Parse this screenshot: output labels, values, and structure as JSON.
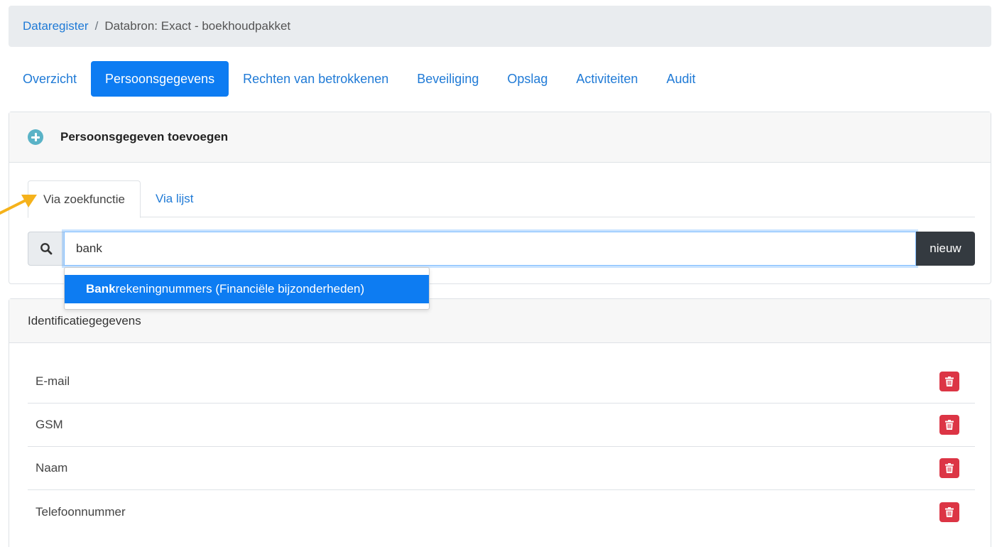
{
  "breadcrumb": {
    "root": "Dataregister",
    "separator": "/",
    "current": "Databron: Exact - boekhoudpakket"
  },
  "main_tabs": [
    {
      "label": "Overzicht",
      "active": false
    },
    {
      "label": "Persoonsgegevens",
      "active": true
    },
    {
      "label": "Rechten van betrokkenen",
      "active": false
    },
    {
      "label": "Beveiliging",
      "active": false
    },
    {
      "label": "Opslag",
      "active": false
    },
    {
      "label": "Activiteiten",
      "active": false
    },
    {
      "label": "Audit",
      "active": false
    }
  ],
  "add_card": {
    "title": "Persoonsgegeven toevoegen",
    "sub_tabs": [
      {
        "label": "Via zoekfunctie",
        "active": true
      },
      {
        "label": "Via lijst",
        "active": false
      }
    ],
    "search_value": "bank",
    "new_label": "nieuw",
    "suggestion": {
      "match": "Bank",
      "rest": "rekeningnummers (Financiële bijzonderheden)"
    }
  },
  "section": {
    "title": "Identificatiegegevens",
    "items": [
      "E-mail",
      "GSM",
      "Naam",
      "Telefoonnummer"
    ]
  },
  "colors": {
    "primary": "#0d7cf2",
    "link": "#1f7ad6",
    "danger": "#dc3545",
    "dark_button": "#343a40",
    "plus_icon": "#5ab3c7",
    "annotation_arrow": "#f5b21b"
  }
}
